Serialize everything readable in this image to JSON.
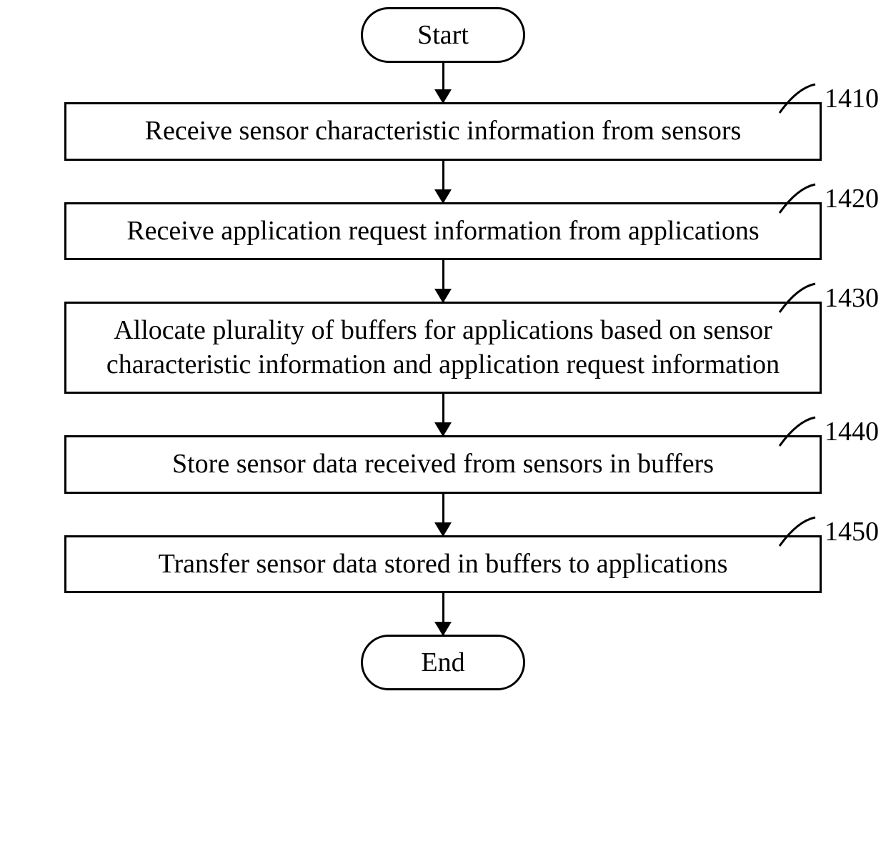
{
  "terminals": {
    "start": "Start",
    "end": "End"
  },
  "steps": [
    {
      "id": "1410",
      "text": "Receive sensor characteristic information from sensors"
    },
    {
      "id": "1420",
      "text": "Receive application request information from applications"
    },
    {
      "id": "1430",
      "text": "Allocate plurality of buffers for applications based on sensor characteristic information and application request information"
    },
    {
      "id": "1440",
      "text": "Store sensor data received from sensors in buffers"
    },
    {
      "id": "1450",
      "text": "Transfer sensor data stored in buffers to applications"
    }
  ]
}
